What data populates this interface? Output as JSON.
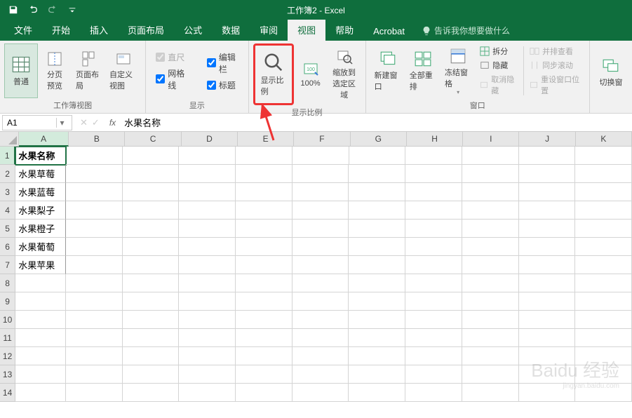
{
  "title": "工作簿2 - Excel",
  "tabs": [
    "文件",
    "开始",
    "插入",
    "页面布局",
    "公式",
    "数据",
    "审阅",
    "视图",
    "帮助",
    "Acrobat"
  ],
  "tell_me": "告诉我你想要做什么",
  "ribbon": {
    "views": {
      "normal": "普通",
      "page_break": "分页\n预览",
      "page_layout": "页面布局",
      "custom": "自定义视图",
      "group_label": "工作簿视图"
    },
    "show": {
      "ruler": "直尺",
      "formula_bar": "编辑栏",
      "gridlines": "网格线",
      "headings": "标题",
      "group_label": "显示"
    },
    "zoom": {
      "zoom": "显示比例",
      "hundred": "100%",
      "fit": "缩放到\n选定区域",
      "group_label": "显示比例"
    },
    "window": {
      "new_win": "新建窗口",
      "arrange": "全部重排",
      "freeze": "冻结窗格",
      "split": "拆分",
      "hide": "隐藏",
      "unhide": "取消隐藏",
      "side": "并排查看",
      "sync": "同步滚动",
      "reset": "重设窗口位置",
      "group_label": "窗口"
    },
    "switch": "切换窗"
  },
  "namebox": "A1",
  "formula": "水果名称",
  "columns": [
    "A",
    "B",
    "C",
    "D",
    "E",
    "F",
    "G",
    "H",
    "I",
    "J",
    "K"
  ],
  "rows_data": [
    "水果名称",
    "水果草莓",
    "水果蓝莓",
    "水果梨子",
    "水果橙子",
    "水果葡萄",
    "水果苹果"
  ],
  "row_count": 14,
  "watermark": {
    "main": "Baidu 经验",
    "sub": "jingyan.baidu.com"
  }
}
